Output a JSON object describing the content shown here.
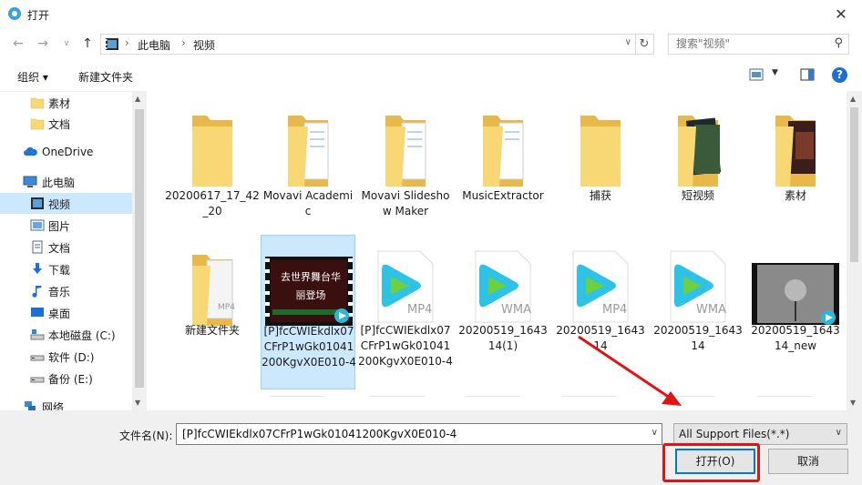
{
  "window": {
    "title": "打开",
    "close": "✕"
  },
  "address": {
    "crumbs": [
      "此电脑",
      "视频"
    ]
  },
  "search": {
    "placeholder": "搜索\"视频\""
  },
  "toolbar": {
    "organize": "组织 ▾",
    "new_folder": "新建文件夹",
    "help": "?"
  },
  "sidebar": {
    "items": [
      {
        "label": "素材",
        "icon": "folder-icon"
      },
      {
        "label": "文档",
        "icon": "folder-icon"
      },
      {
        "label": "OneDrive",
        "icon": "cloud-icon"
      },
      {
        "label": "此电脑",
        "icon": "computer-icon"
      },
      {
        "label": "视频",
        "icon": "video-icon"
      },
      {
        "label": "图片",
        "icon": "picture-icon"
      },
      {
        "label": "文档",
        "icon": "document-icon"
      },
      {
        "label": "下载",
        "icon": "download-icon"
      },
      {
        "label": "音乐",
        "icon": "music-icon"
      },
      {
        "label": "桌面",
        "icon": "desktop-icon"
      },
      {
        "label": "本地磁盘 (C:)",
        "icon": "drive-icon"
      },
      {
        "label": "软件 (D:)",
        "icon": "drive-icon"
      },
      {
        "label": "备份 (E:)",
        "icon": "drive-icon"
      },
      {
        "label": "网络",
        "icon": "network-icon"
      }
    ]
  },
  "files": [
    {
      "name": "20200617_17_42_20",
      "kind": "folder"
    },
    {
      "name": "Movavi Academic",
      "kind": "folder-doc"
    },
    {
      "name": "Movavi Slideshow Maker",
      "kind": "folder-doc"
    },
    {
      "name": "MusicExtractor",
      "kind": "folder-doc"
    },
    {
      "name": "捕获",
      "kind": "folder"
    },
    {
      "name": "短视频",
      "kind": "folder-media"
    },
    {
      "name": "素材",
      "kind": "folder-media"
    },
    {
      "name": "新建文件夹",
      "kind": "folder-mp4"
    },
    {
      "name": "[P]fcCWIEkdlx07CFrP1wGk01041200KgvX0E010-4",
      "kind": "video-thumb",
      "thumb_text": "去世界舞台华丽登场"
    },
    {
      "name": "[P]fcCWIEkdlx07CFrP1wGk01041200KgvX0E010-4",
      "kind": "player",
      "ext": "MP4"
    },
    {
      "name": "20200519_164314(1)",
      "kind": "player",
      "ext": "WMA"
    },
    {
      "name": "20200519_164314",
      "kind": "player",
      "ext": "MP4"
    },
    {
      "name": "20200519_164314",
      "kind": "player",
      "ext": "WMA"
    },
    {
      "name": "20200519_164314_new",
      "kind": "video-thumb2"
    }
  ],
  "footer": {
    "filename_label": "文件名(N):",
    "filename_value": "[P]fcCWIEkdlx07CFrP1wGk01041200KgvX0E010-4",
    "filter_value": "All Support Files(*.*)",
    "open_label": "打开(O)",
    "cancel_label": "取消"
  },
  "colors": {
    "accent": "#0078d7",
    "selection": "#cce8ff",
    "highlight": "#e11414",
    "folder": "#f8d775"
  }
}
